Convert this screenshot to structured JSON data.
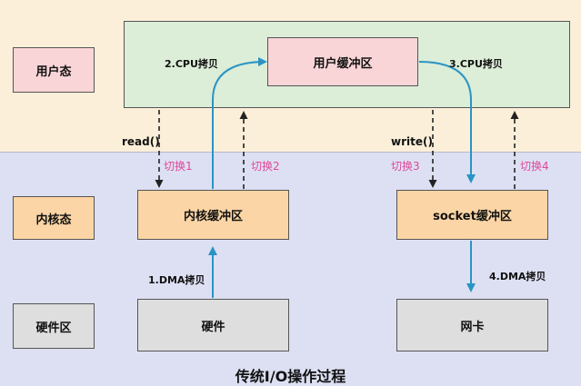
{
  "zones": {
    "user": "用户态",
    "kernel": "内核态",
    "hardware": "硬件区"
  },
  "boxes": {
    "user_buffer": "用户缓冲区",
    "kernel_buffer": "内核缓冲区",
    "socket_buffer": "socket缓冲区",
    "hardware": "硬件",
    "nic": "网卡"
  },
  "steps": {
    "dma1": "1.DMA拷贝",
    "cpu2": "2.CPU拷贝",
    "cpu3": "3.CPU拷贝",
    "dma4": "4.DMA拷贝"
  },
  "calls": {
    "read": "read()",
    "write": "write()"
  },
  "switches": [
    "切换1",
    "切换2",
    "切换3",
    "切换4"
  ],
  "caption": "传统I/O操作过程",
  "colors": {
    "user_band": "#fbefd9",
    "kernel_band": "#dde0f3",
    "pink": "#f9d5d8",
    "peach": "#fbd5a5",
    "grey": "#dedede",
    "green": "#dcedd8",
    "arrow_blue": "#2a94c4",
    "switch_pink": "#e0479a"
  }
}
